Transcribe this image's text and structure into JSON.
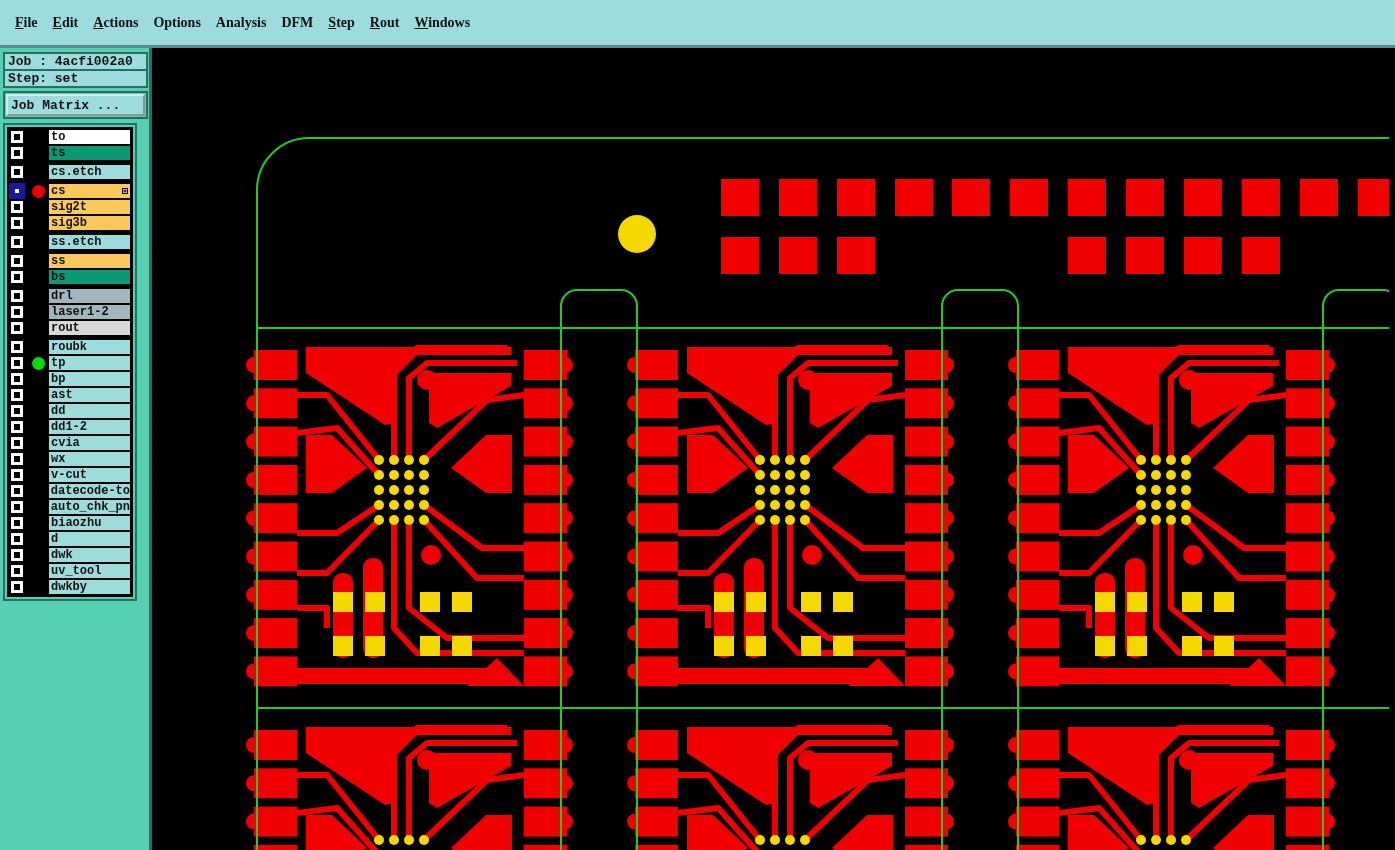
{
  "menu": [
    {
      "label": "File",
      "underlined": true
    },
    {
      "label": "Edit",
      "underlined": true
    },
    {
      "label": "Actions",
      "underlined": true
    },
    {
      "label": "Options",
      "underlined": false
    },
    {
      "label": "Analysis",
      "underlined": false
    },
    {
      "label": "DFM",
      "underlined": false
    },
    {
      "label": "Step",
      "underlined": true
    },
    {
      "label": "Rout",
      "underlined": true
    },
    {
      "label": "Windows",
      "underlined": true
    }
  ],
  "job": "Job : 4acfi002a0",
  "step": "Step: set",
  "job_matrix_button": "Job Matrix ...",
  "layer_groups": [
    {
      "layers": [
        {
          "name": "to",
          "color": "#ffffff",
          "selected": false,
          "checked": false
        },
        {
          "name": "ts",
          "color": "#0a9a76",
          "selected": false,
          "checked": false
        }
      ]
    },
    {
      "layers": [
        {
          "name": "cs.etch",
          "color": "#9cdcdc",
          "selected": false,
          "checked": false
        }
      ]
    },
    {
      "layers": [
        {
          "name": "cs",
          "color": "#ffc85a",
          "selected": true,
          "checked": false,
          "status_dot": {
            "color": "#ee0000"
          }
        },
        {
          "name": "sig2t",
          "color": "#ffc85a",
          "selected": false,
          "checked": false
        },
        {
          "name": "sig3b",
          "color": "#ffc85a",
          "selected": false,
          "checked": false
        }
      ]
    },
    {
      "layers": [
        {
          "name": "ss.etch",
          "color": "#9cdcdc",
          "selected": false,
          "checked": false
        }
      ]
    },
    {
      "layers": [
        {
          "name": "ss",
          "color": "#ffc85a",
          "selected": false,
          "checked": false
        },
        {
          "name": "bs",
          "color": "#0a9a76",
          "selected": false,
          "checked": false
        }
      ]
    },
    {
      "layers": [
        {
          "name": "drl",
          "color": "#a2b6be",
          "selected": false,
          "checked": false
        },
        {
          "name": "laser1-2",
          "color": "#a2b6be",
          "selected": false,
          "checked": false
        },
        {
          "name": "rout",
          "color": "#d8d8d8",
          "selected": false,
          "checked": false
        }
      ]
    },
    {
      "layers": [
        {
          "name": "roubk",
          "color": "#9cdcdc",
          "selected": false,
          "checked": false
        },
        {
          "name": "tp",
          "color": "#9cdcdc",
          "selected": false,
          "checked": false,
          "status_dot": {
            "color": "#00dd00"
          }
        },
        {
          "name": "bp",
          "color": "#9cdcdc",
          "selected": false,
          "checked": false
        },
        {
          "name": "ast",
          "color": "#9cdcdc",
          "selected": false,
          "checked": false
        },
        {
          "name": "dd",
          "color": "#9cdcdc",
          "selected": false,
          "checked": false
        },
        {
          "name": "dd1-2",
          "color": "#9cdcdc",
          "selected": false,
          "checked": false
        },
        {
          "name": "cvia",
          "color": "#9cdcdc",
          "selected": false,
          "checked": false
        },
        {
          "name": "wx",
          "color": "#9cdcdc",
          "selected": false,
          "checked": false
        },
        {
          "name": "v-cut",
          "color": "#9cdcdc",
          "selected": false,
          "checked": false
        },
        {
          "name": "datecode-to",
          "color": "#9cdcdc",
          "selected": false,
          "checked": false
        },
        {
          "name": "auto_chk_pn",
          "color": "#9cdcdc",
          "selected": false,
          "checked": false
        },
        {
          "name": "biaozhu",
          "color": "#9cdcdc",
          "selected": false,
          "checked": false
        },
        {
          "name": "d",
          "color": "#9cdcdc",
          "selected": false,
          "checked": false
        },
        {
          "name": "dwk",
          "color": "#9cdcdc",
          "selected": false,
          "checked": false
        },
        {
          "name": "uv_tool",
          "color": "#9cdcdc",
          "selected": false,
          "checked": false
        },
        {
          "name": "dwkby",
          "color": "#9cdcdc",
          "selected": false,
          "checked": false
        }
      ]
    }
  ]
}
